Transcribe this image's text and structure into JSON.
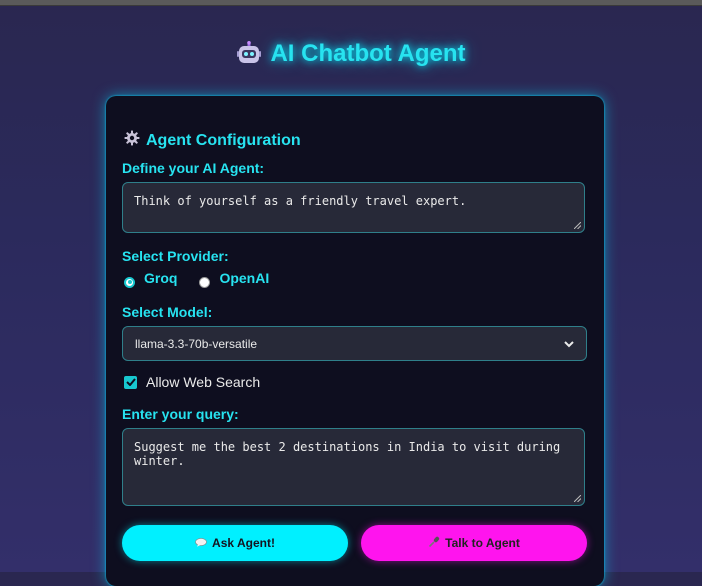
{
  "app": {
    "title": "AI Chatbot Agent"
  },
  "config": {
    "section_title": "Agent Configuration",
    "define_label": "Define your AI Agent:",
    "define_value": "Think of yourself as a friendly travel expert.",
    "provider_label": "Select Provider:",
    "providers": [
      {
        "label": "Groq",
        "selected": true
      },
      {
        "label": "OpenAI",
        "selected": false
      }
    ],
    "model_label": "Select Model:",
    "model_value": "llama-3.3-70b-versatile",
    "web_search_label": "Allow Web Search",
    "web_search_checked": true,
    "query_label": "Enter your query:",
    "query_value": "Suggest me the best 2 destinations in India to visit during winter."
  },
  "buttons": {
    "ask_label": "Ask Agent!",
    "talk_label": "Talk to Agent"
  },
  "colors": {
    "accent": "#27e3f0",
    "ask_button": "#00f0ff",
    "talk_button": "#ff14ee",
    "card_bg": "#0e0e1f"
  },
  "icons": {
    "title": "robot-icon",
    "section": "gear-icon",
    "select": "chevron-down-icon",
    "ask": "speech-bubble-icon",
    "talk": "microphone-icon"
  }
}
